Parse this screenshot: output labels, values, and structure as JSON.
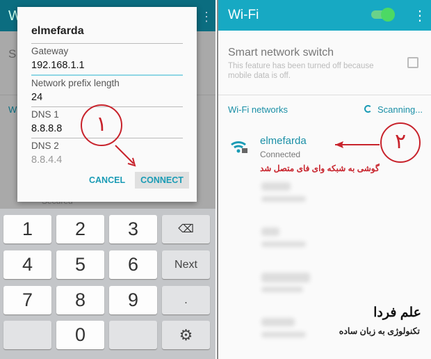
{
  "left_screen": {
    "header_title_partial": "W",
    "bg_item_partial": "S",
    "bg_section_partial": "W",
    "bg_secured": "Secured",
    "dialog": {
      "title": "elmefarda",
      "fields": [
        {
          "label": "Gateway",
          "value": "192.168.1.1"
        },
        {
          "label": "Network prefix length",
          "value": "24"
        },
        {
          "label": "DNS 1",
          "value": "8.8.8.8"
        },
        {
          "label": "DNS 2",
          "value": "8.8.4.4"
        }
      ],
      "cancel_label": "CANCEL",
      "connect_label": "CONNECT"
    },
    "annotation_step": "١",
    "keyboard": {
      "keys": [
        "1",
        "2",
        "3",
        "4",
        "5",
        "6",
        "Next",
        "7",
        "8",
        "9",
        ".",
        "0"
      ]
    }
  },
  "right_screen": {
    "header_title": "Wi-Fi",
    "wifi_toggle_on": true,
    "smart_switch": {
      "title": "Smart network switch",
      "description": "This feature has been turned off because mobile data is off.",
      "checked": false
    },
    "section_title": "Wi-Fi networks",
    "scanning_label": "Scanning...",
    "network": {
      "name": "elmefarda",
      "status": "Connected"
    },
    "annotation_step": "٢",
    "annotation_text": "گوشی به شبکه وای فای متصل شد",
    "watermark_title": "علم فردا",
    "watermark_subtitle": "تکنولوژی به زبان ساده"
  },
  "colors": {
    "accent": "#17a9c3",
    "annotation": "#c8232c",
    "toggle": "#4cd964"
  }
}
